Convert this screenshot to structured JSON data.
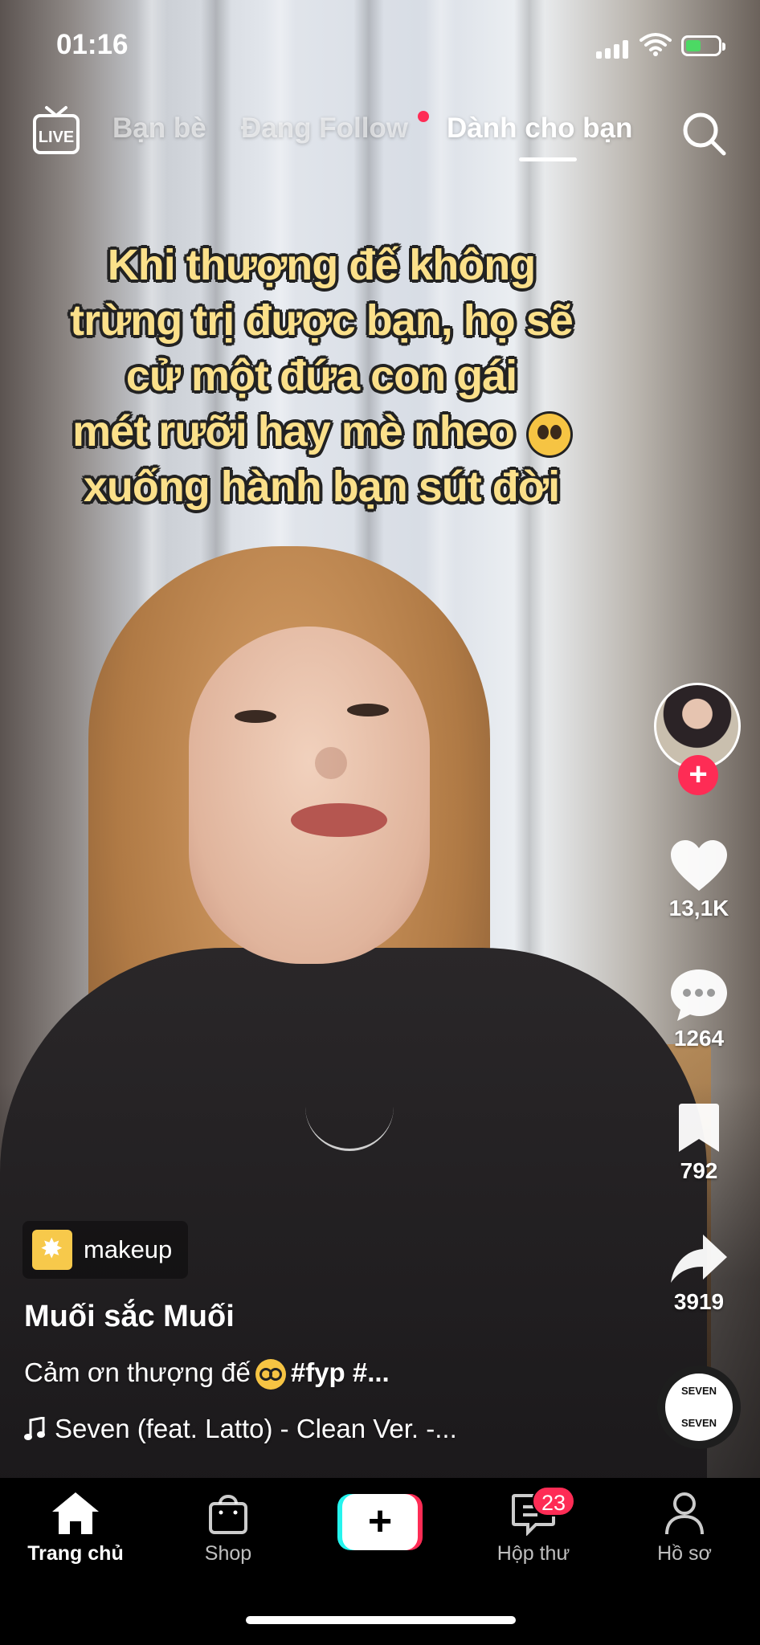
{
  "status_bar": {
    "time": "01:16"
  },
  "top_nav": {
    "live_label": "LIVE",
    "tabs": [
      {
        "label": "Bạn bè",
        "active": false
      },
      {
        "label": "Đang Follow",
        "active": false,
        "has_dot": true
      },
      {
        "label": "Dành cho bạn",
        "active": true
      }
    ]
  },
  "video": {
    "overlay_lines": [
      "Khi thượng đế không",
      "trừng trị được bạn, họ sẽ",
      "cử một đứa con gái",
      "mét rưỡi hay mè nheo",
      "xuống hành bạn sút đời"
    ],
    "overlay_emoji": "pleading-face"
  },
  "sidebar": {
    "likes": "13,1K",
    "comments": "1264",
    "saves": "792",
    "shares": "3919",
    "music_disc_text_top": "SEVEN",
    "music_disc_text_bottom": "SEVEN"
  },
  "post": {
    "tag_label": "makeup",
    "username": "Muối sắc Muối",
    "caption_text": "Cảm ơn thượng đế",
    "caption_hashtags": "#fyp #...",
    "music": "Seven (feat. Latto) - Clean Ver. -..."
  },
  "tab_bar": {
    "items": [
      {
        "label": "Trang chủ",
        "icon": "home-icon",
        "active": true
      },
      {
        "label": "Shop",
        "icon": "shopping-bag-icon",
        "active": false
      },
      {
        "label": "",
        "icon": "create-plus-icon",
        "active": false
      },
      {
        "label": "Hộp thư",
        "icon": "inbox-icon",
        "active": false,
        "badge": "23"
      },
      {
        "label": "Hồ sơ",
        "icon": "profile-icon",
        "active": false
      }
    ]
  },
  "colors": {
    "accent": "#fe2c55",
    "accent_cyan": "#25f4ee",
    "caption_yellow": "#fbe08a"
  }
}
